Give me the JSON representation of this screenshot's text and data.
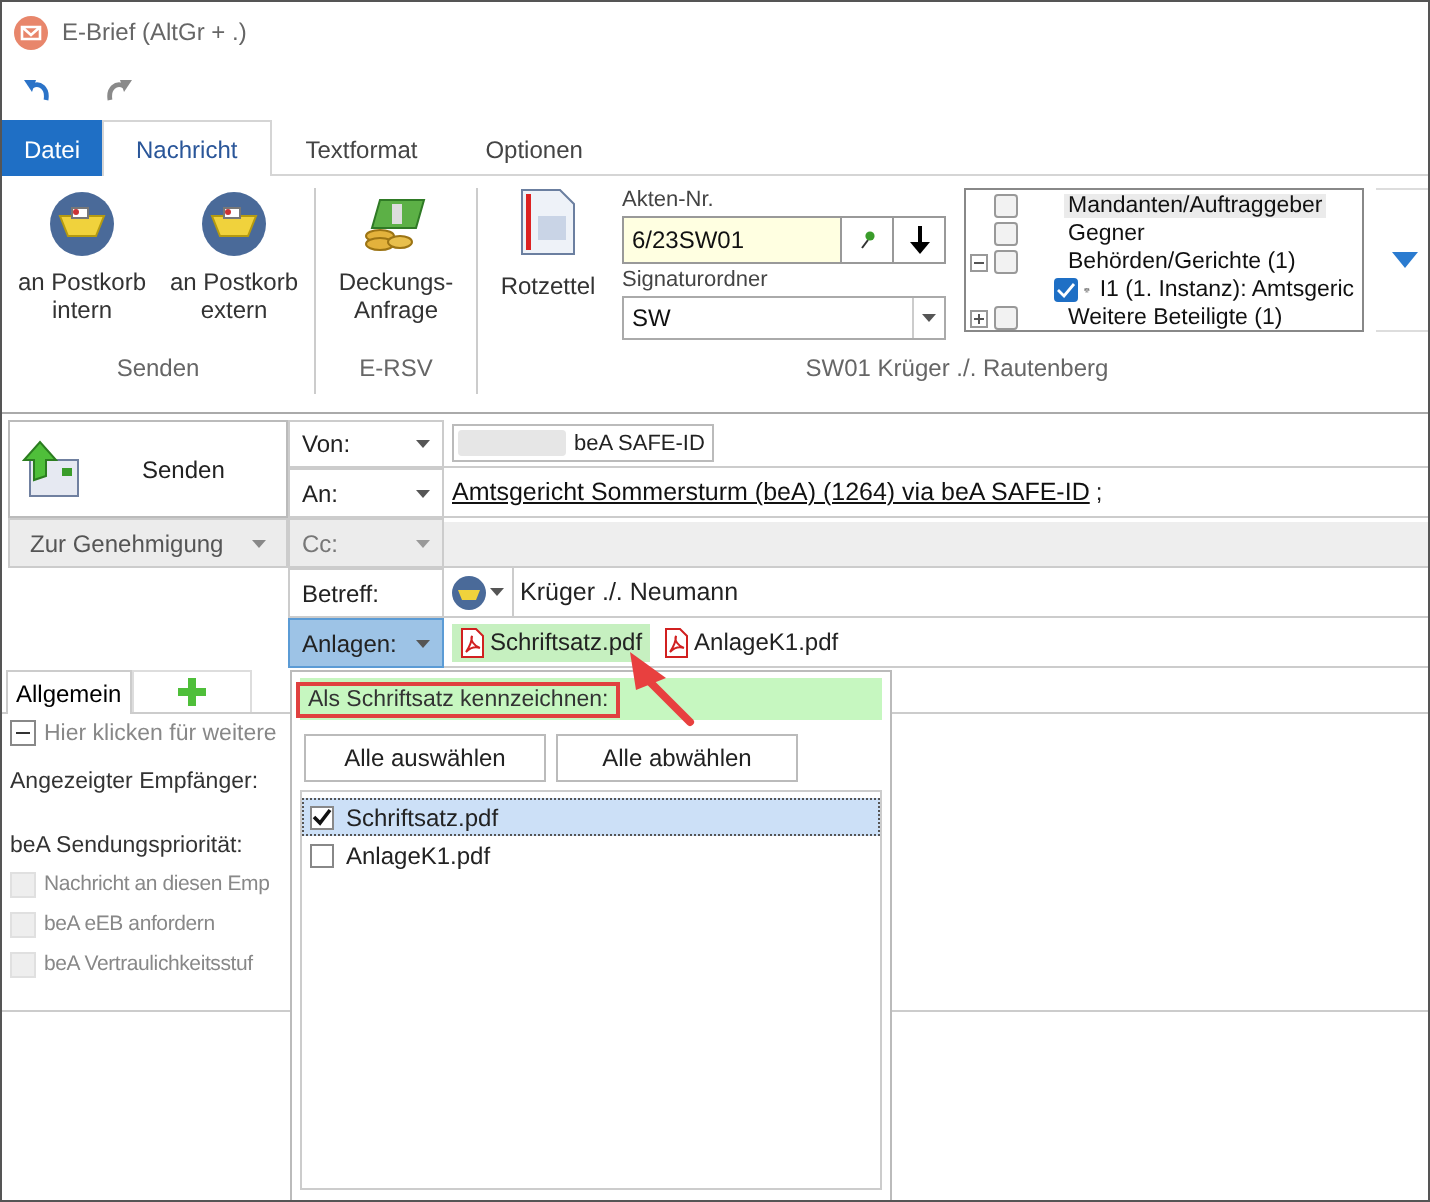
{
  "window": {
    "title": "E-Brief (AltGr + .)"
  },
  "ribbon_tabs": [
    {
      "label": "Datei",
      "kind": "file",
      "selected": false
    },
    {
      "label": "Nachricht",
      "kind": "tab",
      "selected": true
    },
    {
      "label": "Textformat",
      "kind": "tab",
      "selected": false
    },
    {
      "label": "Optionen",
      "kind": "tab",
      "selected": false
    }
  ],
  "ribbon_groups": [
    {
      "label": "Senden",
      "buttons": [
        {
          "label": "an Postkorb intern",
          "kind": "basket"
        },
        {
          "label": "an Postkorb extern",
          "kind": "basket"
        }
      ]
    },
    {
      "label": "E-RSV",
      "buttons": [
        {
          "label": "Deckungs-Anfrage",
          "kind": "money"
        }
      ]
    }
  ],
  "case_panel": {
    "button": "Rotzettel",
    "file_number_label": "Akten-Nr.",
    "file_number": "6/23SW01",
    "signature_label": "Signaturordner",
    "signature": "SW",
    "group_label": "SW01 Krüger ./. Rautenberg",
    "tree": [
      {
        "label": "Mandanten/Auftraggeber",
        "checked": false,
        "selected": true
      },
      {
        "label": "Gegner",
        "checked": false,
        "selected": false
      },
      {
        "label": "Behörden/Gerichte (1)",
        "checked": false,
        "selected": false,
        "expanded": true,
        "children": [
          {
            "label": "I1 (1. Instanz): Amtsgeric",
            "checked": true,
            "selected": false,
            "kind": "court"
          }
        ]
      },
      {
        "label": "Weitere Beteiligte (1)",
        "checked": false,
        "selected": false,
        "expanded": false
      }
    ]
  },
  "send_button": "Senden",
  "approval_button": "Zur Genehmigung",
  "fields": [
    {
      "label": "Von:",
      "kind": "from",
      "value": "beA SAFE-ID",
      "disabled": false,
      "selected": false
    },
    {
      "label": "An:",
      "kind": "to",
      "value": "Amtsgericht Sommersturm (beA) (1264) via beA SAFE-ID",
      "suffix": ";",
      "disabled": false,
      "selected": false
    },
    {
      "label": "Cc:",
      "kind": "cc",
      "disabled": true,
      "selected": false
    },
    {
      "label": "Betreff:",
      "kind": "subject",
      "value": "Krüger ./. Neumann",
      "disabled": false,
      "selected": false
    },
    {
      "label": "Anlagen:",
      "kind": "attachments",
      "disabled": false,
      "selected": true
    }
  ],
  "attachments": [
    {
      "name": "Schriftsatz.pdf",
      "highlighted": true
    },
    {
      "name": "AnlageK1.pdf",
      "highlighted": false
    }
  ],
  "detail_tabs": [
    {
      "label": "Allgemein",
      "selected": true
    }
  ],
  "detail": {
    "expander": "Hier klicken für weitere",
    "expanded": true,
    "recipient_label": "Angezeigter Empfänger:",
    "priority_label": "beA Sendungspriorität:",
    "options": [
      {
        "label": "Nachricht an diesen Emp",
        "checked": false,
        "disabled": true
      },
      {
        "label": "beA eEB anfordern",
        "checked": false,
        "disabled": true
      },
      {
        "label": "beA Vertraulichkeitsstuf",
        "checked": false,
        "disabled": true
      }
    ]
  },
  "popup": {
    "heading": "Als Schriftsatz kennzeichnen:",
    "buttons": [
      "Alle auswählen",
      "Alle abwählen"
    ],
    "items": [
      {
        "name": "Schriftsatz.pdf",
        "checked": true,
        "selected": true
      },
      {
        "name": "AnlageK1.pdf",
        "checked": false,
        "selected": false
      }
    ]
  }
}
